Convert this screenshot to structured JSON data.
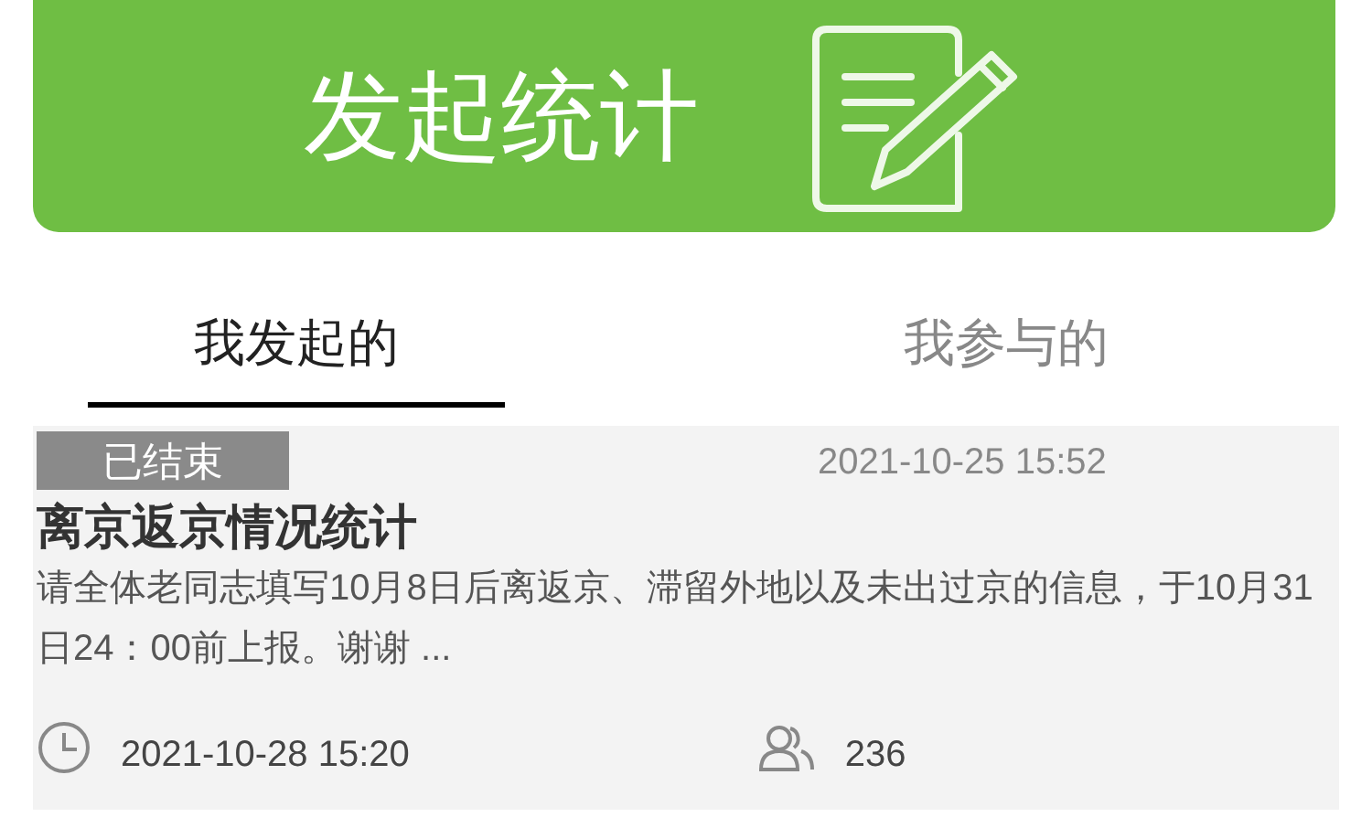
{
  "banner": {
    "label": "发起统计"
  },
  "tabs": [
    {
      "label": "我发起的",
      "selected": true
    },
    {
      "label": "我参与的",
      "selected": false
    }
  ],
  "survey": {
    "status": "已结束",
    "created": "2021-10-25 15:52",
    "title": "离京返京情况统计",
    "description": "请全体老同志填写10月8日后离返京、滞留外地以及未出过京的信息，于10月31日24：00前上报。谢谢 ...",
    "deadline": "2021-10-28 15:20",
    "participants": "236"
  }
}
